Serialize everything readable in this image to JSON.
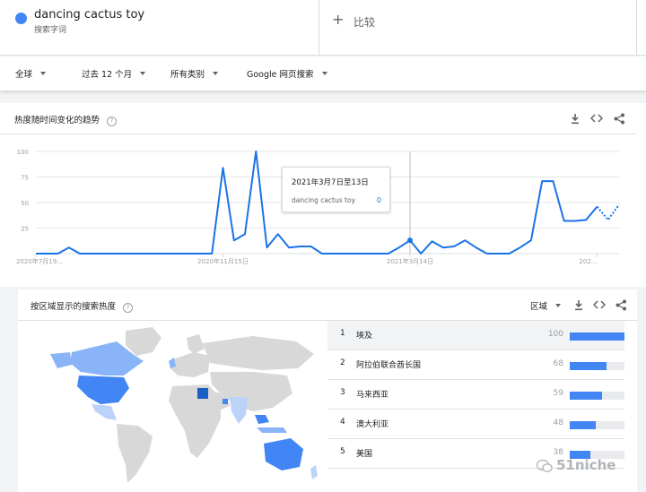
{
  "search_term": {
    "name": "dancing cactus toy",
    "sublabel": "搜索字词",
    "color": "#4285f4"
  },
  "compare": {
    "plus": "+",
    "label": "比较"
  },
  "filters": [
    {
      "label": "全球"
    },
    {
      "label": "过去 12 个月"
    },
    {
      "label": "所有类别"
    },
    {
      "label": "Google 网页搜索"
    }
  ],
  "time_card": {
    "title": "热度随时间变化的趋势",
    "help": "?",
    "icons": {
      "download": "↓",
      "embed": "<>",
      "share": "share-icon"
    }
  },
  "tooltip": {
    "date": "2021年3月7日至13日",
    "term": "dancing cactus toy",
    "value": "0"
  },
  "chart_data": {
    "type": "line",
    "y_ticks": [
      "100",
      "75",
      "50",
      "25"
    ],
    "ylim": [
      0,
      100
    ],
    "x_tick_labels": [
      "2020年7月19...",
      "2020年11月15日",
      "2021年3月14日",
      "202..."
    ],
    "x_tick_positions": [
      0,
      17,
      34,
      51
    ],
    "series": [
      {
        "color": "#1a73e8",
        "values": [
          0,
          0,
          0,
          6,
          0,
          0,
          0,
          0,
          0,
          0,
          0,
          0,
          0,
          0,
          0,
          0,
          0,
          84,
          13,
          19,
          100,
          6,
          19,
          6,
          7,
          7,
          0,
          0,
          0,
          0,
          0,
          0,
          0,
          6,
          13,
          0,
          12,
          6,
          7,
          13,
          6,
          0,
          0,
          0,
          6,
          13,
          71,
          71,
          32,
          32,
          33,
          46,
          33,
          48
        ]
      }
    ],
    "partial_from_index": 51,
    "grid": true
  },
  "region_card": {
    "title": "按区域显示的搜索热度",
    "help": "?",
    "selector": "区域",
    "rows": [
      {
        "rank": "1",
        "name": "埃及",
        "value": "100",
        "fraction": 1.0
      },
      {
        "rank": "2",
        "name": "阿拉伯联合酋长国",
        "value": "68",
        "fraction": 0.68
      },
      {
        "rank": "3",
        "name": "马来西亚",
        "value": "59",
        "fraction": 0.59
      },
      {
        "rank": "4",
        "name": "澳大利亚",
        "value": "48",
        "fraction": 0.48
      },
      {
        "rank": "5",
        "name": "美国",
        "value": "38",
        "fraction": 0.38
      }
    ]
  },
  "watermark": {
    "text": "51niche"
  }
}
